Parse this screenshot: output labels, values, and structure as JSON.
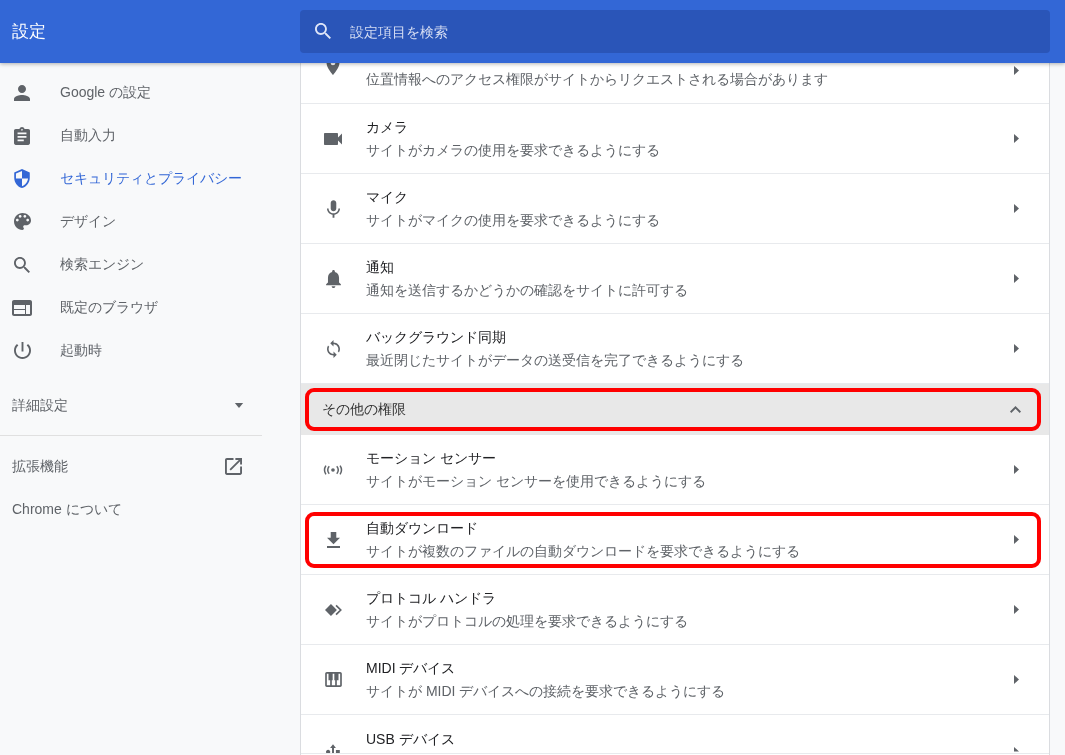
{
  "header": {
    "title": "設定",
    "search": {
      "placeholder": "設定項目を検索"
    }
  },
  "sidebar": {
    "items": [
      {
        "label": "Google の設定",
        "selected": false
      },
      {
        "label": "自動入力",
        "selected": false
      },
      {
        "label": "セキュリティとプライバシー",
        "selected": true
      },
      {
        "label": "デザイン",
        "selected": false
      },
      {
        "label": "検索エンジン",
        "selected": false
      },
      {
        "label": "既定のブラウザ",
        "selected": false
      },
      {
        "label": "起動時",
        "selected": false
      }
    ],
    "advanced": {
      "label": "詳細設定",
      "expanded": false
    },
    "links": [
      {
        "label": "拡張機能",
        "external": true
      },
      {
        "label": "Chrome について",
        "external": false
      }
    ]
  },
  "permissions": [
    {
      "description": "位置情報へのアクセス権限がサイトからリクエストされる場合があります",
      "highlighted": false
    },
    {
      "title": "カメラ",
      "description": "サイトがカメラの使用を要求できるようにする",
      "highlighted": false
    },
    {
      "title": "マイク",
      "description": "サイトがマイクの使用を要求できるようにする",
      "highlighted": false
    },
    {
      "title": "通知",
      "description": "通知を送信するかどうかの確認をサイトに許可する",
      "highlighted": false
    },
    {
      "title": "バックグラウンド同期",
      "description": "最近閉じたサイトがデータの送受信を完了できるようにする",
      "highlighted": false
    }
  ],
  "other_permissions": {
    "label": "その他の権限",
    "expanded": true,
    "highlighted": true,
    "rows": [
      {
        "title": "モーション センサー",
        "description": "サイトがモーション センサーを使用できるようにする",
        "highlighted": false
      },
      {
        "title": "自動ダウンロード",
        "description": "サイトが複数のファイルの自動ダウンロードを要求できるようにする",
        "highlighted": true
      },
      {
        "title": "プロトコル ハンドラ",
        "description": "サイトがプロトコルの処理を要求できるようにする",
        "highlighted": false
      },
      {
        "title": "MIDI デバイス",
        "description": "サイトが MIDI デバイスへの接続を要求できるようにする",
        "highlighted": false
      },
      {
        "title": "USB デバイス",
        "highlighted": false
      }
    ]
  }
}
